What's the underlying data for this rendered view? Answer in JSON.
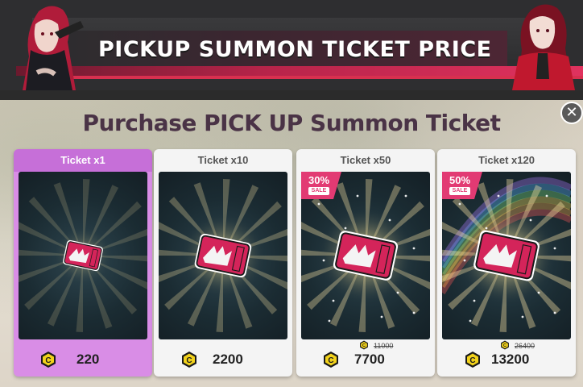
{
  "banner": {
    "title": "PICKUP SUMMON TICKET PRICE"
  },
  "dialog": {
    "title": "Purchase PICK UP Summon Ticket",
    "close_icon": "close-icon"
  },
  "colors": {
    "accent_pink": "#e23a73",
    "selected_card": "#d98de6",
    "coin_yellow": "#f2d21b",
    "title_text": "#4a3346"
  },
  "cards": [
    {
      "label": "Ticket x1",
      "price": "220",
      "old_price": "",
      "sale_percent": "",
      "sale_word": "",
      "selected": true
    },
    {
      "label": "Ticket x10",
      "price": "2200",
      "old_price": "",
      "sale_percent": "",
      "sale_word": "",
      "selected": false
    },
    {
      "label": "Ticket x50",
      "price": "7700",
      "old_price": "11000",
      "sale_percent": "30%",
      "sale_word": "SALE",
      "selected": false
    },
    {
      "label": "Ticket x120",
      "price": "13200",
      "old_price": "26400",
      "sale_percent": "50%",
      "sale_word": "SALE",
      "selected": false
    }
  ]
}
